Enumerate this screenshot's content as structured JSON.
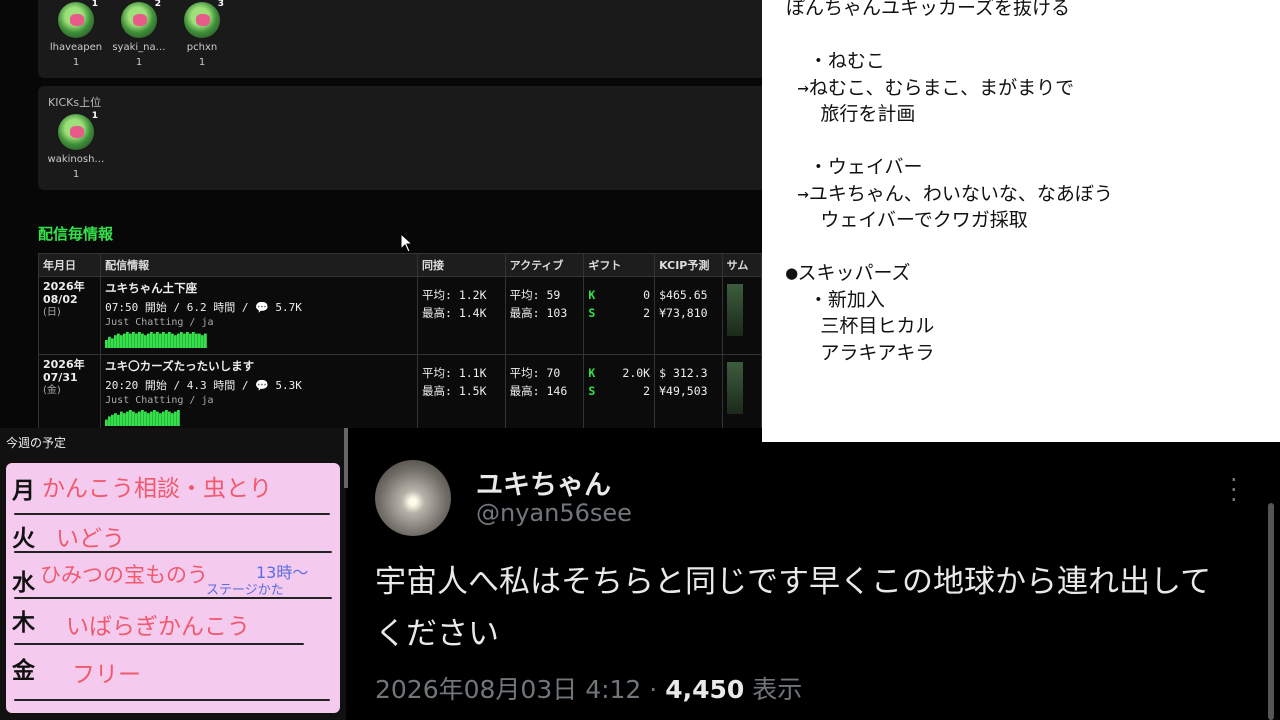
{
  "stats": {
    "top_viewers": [
      {
        "rank": "1",
        "name": "lhaveapen",
        "count": "1"
      },
      {
        "rank": "2",
        "name": "syaki_na…",
        "count": "1"
      },
      {
        "rank": "3",
        "name": "pchxn",
        "count": "1"
      }
    ],
    "kicks_label": "KICKs上位",
    "kicks_viewers": [
      {
        "rank": "1",
        "name": "wakinosh…",
        "count": "1"
      }
    ],
    "section_title": "配信毎情報",
    "table": {
      "headers": [
        "年月日",
        "配信情報",
        "同接",
        "アクティブ",
        "ギフト",
        "KCIP予測",
        "サム"
      ],
      "rows": [
        {
          "year": "2026年",
          "date": "08/02",
          "dow": "(日)",
          "title": "ユキちゃん土下座",
          "start": "07:50 開始 / 6.2 時間  /  💬 5.7K",
          "category": "Just Chatting / ja",
          "concurrent_avg": "平均:  1.2K",
          "concurrent_max": "最高:  1.4K",
          "active_avg": "平均:   59",
          "active_max": "最高:  103",
          "gift_k_mark": "K",
          "gift_k": "0",
          "gift_s_mark": "S",
          "gift_s": "2",
          "kcip_usd": "$465.65",
          "kcip_jpy": "¥73,810",
          "sparkline": [
            5,
            7,
            6,
            8,
            9,
            8,
            9,
            10,
            9,
            10,
            9,
            10,
            9,
            8,
            9,
            10,
            9,
            10,
            9,
            10,
            9,
            10,
            9,
            8,
            9,
            10,
            9,
            10,
            9,
            10,
            9,
            9,
            8,
            9
          ]
        },
        {
          "year": "2026年",
          "date": "07/31",
          "dow": "(金)",
          "title": "ユキ〇カーズたったいします",
          "start": "20:20 開始 / 4.3 時間  /  💬 5.3K",
          "category": "Just Chatting / ja",
          "concurrent_avg": "平均:  1.1K",
          "concurrent_max": "最高:  1.5K",
          "active_avg": "平均:   70",
          "active_max": "最高:  146",
          "gift_k_mark": "K",
          "gift_k": "2.0K",
          "gift_s_mark": "S",
          "gift_s": "2",
          "kcip_usd": "$ 312.3",
          "kcip_jpy": "¥49,503",
          "sparkline": [
            4,
            6,
            7,
            8,
            7,
            9,
            8,
            9,
            10,
            9,
            8,
            9,
            10,
            9,
            8,
            9,
            10,
            9,
            8,
            9,
            10,
            9,
            8,
            9,
            10
          ]
        }
      ]
    }
  },
  "memo": {
    "lines": [
      "ぽんちゃんユキッカーズを抜ける",
      "",
      "  ・ねむこ",
      " →ねむこ、むらまこ、まがまりで",
      "   旅行を計画",
      "",
      "  ・ウェイバー",
      " →ユキちゃん、わいないな、なあぼう",
      "   ウェイバーでクワガ採取",
      "",
      "●スキッパーズ",
      "  ・新加入",
      "   三杯目ヒカル",
      "   アラキアキラ"
    ]
  },
  "schedule": {
    "label": "今週の予定",
    "days": [
      {
        "day": "月",
        "task": "かんこう相談・虫とり"
      },
      {
        "day": "火",
        "task": "いどう"
      },
      {
        "day": "水",
        "task": "ひみつの宝ものう",
        "note": "13時〜",
        "note2": "ステージかた"
      },
      {
        "day": "木",
        "task": "いばらぎかんこう"
      },
      {
        "day": "金",
        "task": "フリー"
      }
    ]
  },
  "tweet": {
    "name": "ユキちゃん",
    "handle": "@nyan56see",
    "text": "宇宙人へ私はそちらと同じです早くこの地球から連れ出してください",
    "timestamp": "2026年08月03日 4:12 · ",
    "views": "4,450",
    "views_suffix": " 表示"
  },
  "colors": {
    "accent_green": "#35e04a",
    "memo_bg": "#ffffff",
    "board_pink": "#f4cbee",
    "tweet_bg": "#000000"
  },
  "icons": [
    "chat-bubble-icon",
    "more-options-icon",
    "mouse-cursor-icon"
  ]
}
